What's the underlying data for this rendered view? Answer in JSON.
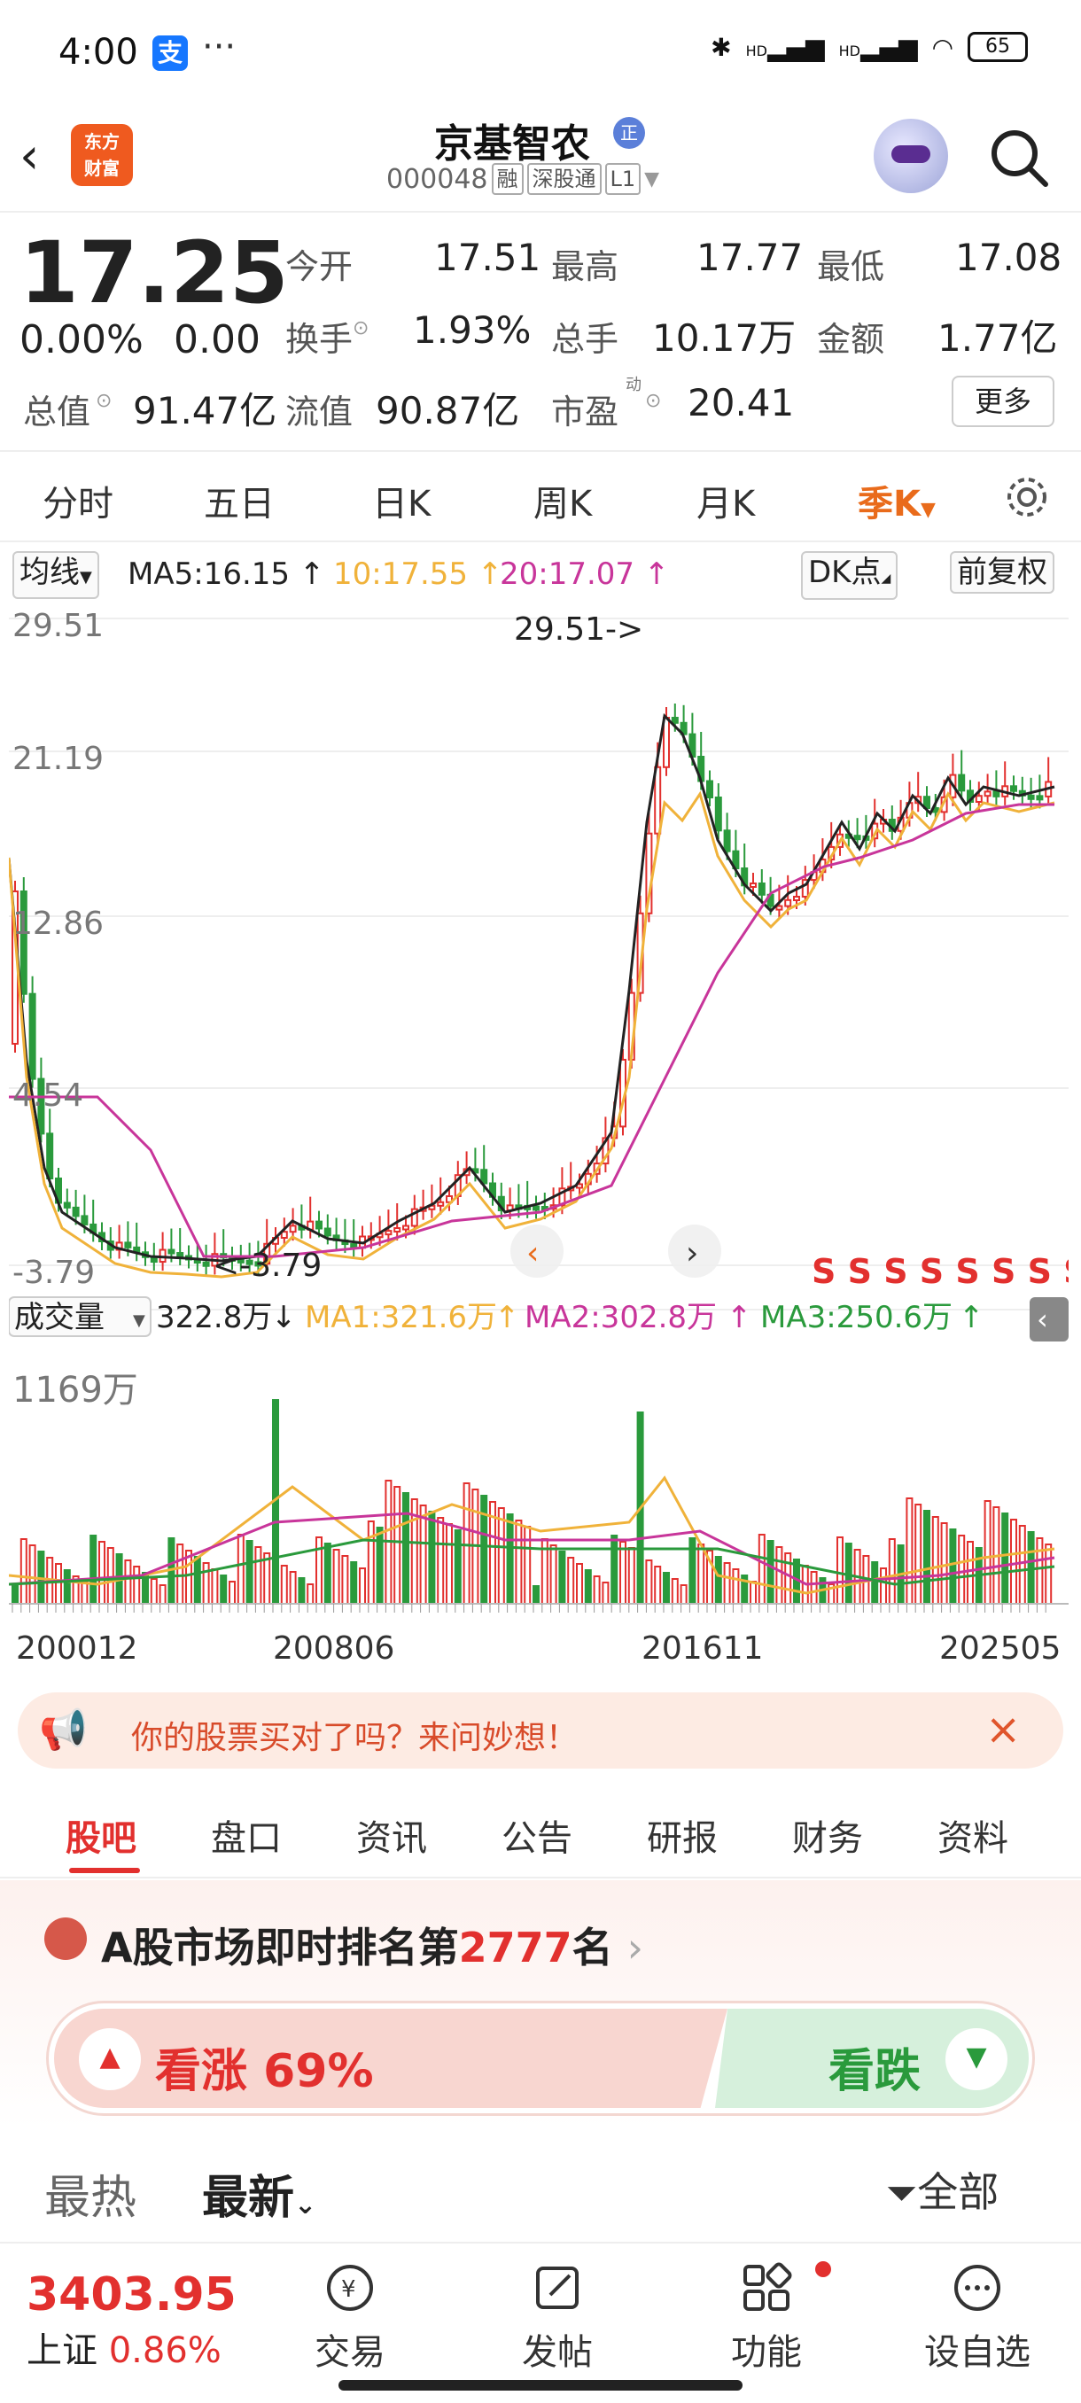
{
  "status": {
    "time": "4:00",
    "pay_icon": "支",
    "dots": "···",
    "battery": "65",
    "signal1": "HD",
    "signal2": "HD"
  },
  "header": {
    "logo_line1": "东方",
    "logo_line2": "财富",
    "name": "京基智农",
    "badge": "正",
    "code": "000048",
    "tag_rong": "融",
    "tag_sgt": "深股通",
    "tag_l1": "L1"
  },
  "quote": {
    "price": "17.25",
    "change_pct": "0.00%",
    "change_val": "0.00",
    "open_label": "今开",
    "open": "17.51",
    "high_label": "最高",
    "high": "17.77",
    "low_label": "最低",
    "low": "17.08",
    "turnover_label": "换手",
    "turnover": "1.93%",
    "vol_label": "总手",
    "vol": "10.17万",
    "amount_label": "金额",
    "amount": "1.77亿",
    "mktcap_label": "总值",
    "mktcap": "91.47亿",
    "float_label": "流值",
    "float": "90.87亿",
    "pe_label": "市盈",
    "pe_sup": "动",
    "pe": "20.41",
    "more": "更多"
  },
  "periods": [
    "分时",
    "五日",
    "日K",
    "周K",
    "月K",
    "季K"
  ],
  "ma": {
    "selector": "均线",
    "ma5": "MA5:16.15",
    "ma10": "10:17.55",
    "ma20": "20:17.07",
    "dk": "DK点",
    "adjust": "前复权",
    "up": "↑"
  },
  "chart_axis": {
    "y1": "29.51",
    "y2": "21.19",
    "y3": "12.86",
    "y4": "4.54",
    "y5": "-3.79",
    "max_note": "29.51->",
    "min_note": "<-3.79",
    "s_marks": "S S S S S S S S"
  },
  "volume": {
    "selector": "成交量",
    "vol": "322.8万",
    "down": "↓",
    "ma1": "MA1:321.6万",
    "ma2": "MA2:302.8万",
    "ma3": "MA3:250.6万",
    "up": "↑",
    "max": "1169万"
  },
  "x_labels": [
    "200012",
    "200806",
    "201611",
    "202505"
  ],
  "promo": {
    "text": "你的股票买对了吗？来问妙想！"
  },
  "info_tabs": [
    "股吧",
    "盘口",
    "资讯",
    "公告",
    "研报",
    "财务",
    "资料"
  ],
  "rank": {
    "prefix": "A股市场即时排名第",
    "number": "2777",
    "suffix": "名"
  },
  "vote": {
    "up_label": "看涨",
    "up_pct": "69%",
    "down_label": "看跌"
  },
  "sort": {
    "hot": "最热",
    "new": "最新",
    "filter": "全部"
  },
  "bottom": {
    "index_value": "3403.95",
    "index_name": "上证",
    "index_pct": "0.86%",
    "trade": "交易",
    "post": "发帖",
    "func": "功能",
    "watch": "设自选"
  },
  "colors": {
    "up": "#e2302e",
    "down": "#2a9a3c",
    "ma5": "#222222",
    "ma10": "#f0b23a",
    "ma20": "#c8359a",
    "accent": "#e96b1b"
  },
  "chart_data": {
    "type": "candlestick",
    "ylim": [
      -3.79,
      29.51
    ],
    "y_ticks": [
      29.51,
      21.19,
      12.86,
      4.54,
      -3.79
    ],
    "x_ticks": [
      "200012",
      "200806",
      "201611",
      "202505"
    ],
    "ma": {
      "MA5": 16.15,
      "MA10": 17.55,
      "MA20": 17.07
    },
    "volume": {
      "last": "322.8万",
      "max": "1169万",
      "MA1": "321.6万",
      "MA2": "302.8万",
      "MA3": "250.6万"
    }
  }
}
